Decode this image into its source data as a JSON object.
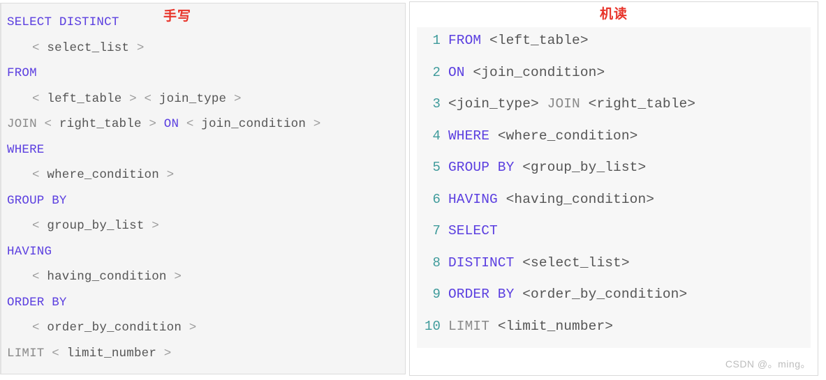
{
  "left_panel": {
    "label": "手写",
    "label_color": "#e8342a",
    "lines": [
      {
        "indent": false,
        "tokens": [
          {
            "t": "SELECT DISTINCT",
            "c": "kw"
          }
        ]
      },
      {
        "indent": true,
        "tokens": [
          {
            "t": "<",
            "c": "ang"
          },
          {
            "t": " select_list ",
            "c": "ph"
          },
          {
            "t": ">",
            "c": "ang"
          }
        ]
      },
      {
        "indent": false,
        "tokens": [
          {
            "t": "FROM",
            "c": "kw"
          }
        ]
      },
      {
        "indent": true,
        "tokens": [
          {
            "t": "<",
            "c": "ang"
          },
          {
            "t": " left_table ",
            "c": "ph"
          },
          {
            "t": ">",
            "c": "ang"
          },
          {
            "t": " ",
            "c": "ph"
          },
          {
            "t": "<",
            "c": "ang"
          },
          {
            "t": " join_type ",
            "c": "ph"
          },
          {
            "t": ">",
            "c": "ang"
          }
        ]
      },
      {
        "indent": false,
        "tokens": [
          {
            "t": "JOIN",
            "c": "gray"
          },
          {
            "t": " ",
            "c": "ph"
          },
          {
            "t": "<",
            "c": "ang"
          },
          {
            "t": " right_table ",
            "c": "ph"
          },
          {
            "t": ">",
            "c": "ang"
          },
          {
            "t": " ",
            "c": "ph"
          },
          {
            "t": "ON",
            "c": "kw"
          },
          {
            "t": " ",
            "c": "ph"
          },
          {
            "t": "<",
            "c": "ang"
          },
          {
            "t": " join_condition ",
            "c": "ph"
          },
          {
            "t": ">",
            "c": "ang"
          }
        ]
      },
      {
        "indent": false,
        "tokens": [
          {
            "t": "WHERE",
            "c": "kw"
          }
        ]
      },
      {
        "indent": true,
        "tokens": [
          {
            "t": "<",
            "c": "ang"
          },
          {
            "t": " where_condition ",
            "c": "ph"
          },
          {
            "t": ">",
            "c": "ang"
          }
        ]
      },
      {
        "indent": false,
        "tokens": [
          {
            "t": "GROUP BY",
            "c": "kw"
          }
        ]
      },
      {
        "indent": true,
        "tokens": [
          {
            "t": "<",
            "c": "ang"
          },
          {
            "t": " group_by_list ",
            "c": "ph"
          },
          {
            "t": ">",
            "c": "ang"
          }
        ]
      },
      {
        "indent": false,
        "tokens": [
          {
            "t": "HAVING",
            "c": "kw"
          }
        ]
      },
      {
        "indent": true,
        "tokens": [
          {
            "t": "<",
            "c": "ang"
          },
          {
            "t": " having_condition ",
            "c": "ph"
          },
          {
            "t": ">",
            "c": "ang"
          }
        ]
      },
      {
        "indent": false,
        "tokens": [
          {
            "t": "ORDER BY",
            "c": "kw"
          }
        ]
      },
      {
        "indent": true,
        "tokens": [
          {
            "t": "<",
            "c": "ang"
          },
          {
            "t": " order_by_condition ",
            "c": "ph"
          },
          {
            "t": ">",
            "c": "ang"
          }
        ]
      },
      {
        "indent": false,
        "tokens": [
          {
            "t": "LIMIT",
            "c": "gray"
          },
          {
            "t": " ",
            "c": "ph"
          },
          {
            "t": "<",
            "c": "ang"
          },
          {
            "t": " limit_number ",
            "c": "ph"
          },
          {
            "t": ">",
            "c": "ang"
          }
        ]
      }
    ],
    "plain_text": [
      "SELECT DISTINCT",
      "    < select_list >",
      "FROM",
      "    < left_table > < join_type >",
      "JOIN < right_table > ON < join_condition >",
      "WHERE",
      "    < where_condition >",
      "GROUP BY",
      "    < group_by_list >",
      "HAVING",
      "    < having_condition >",
      "ORDER BY",
      "    < order_by_condition >",
      "LIMIT < limit_number >"
    ]
  },
  "right_panel": {
    "label": "机读",
    "label_color": "#e8342a",
    "line_number_color": "#3f9b9b",
    "lines": [
      {
        "no": "1",
        "tokens": [
          {
            "t": "FROM",
            "c": "kw"
          },
          {
            "t": " ",
            "c": "ph"
          },
          {
            "t": "<left_table>",
            "c": "ph"
          }
        ]
      },
      {
        "no": "2",
        "tokens": [
          {
            "t": "ON",
            "c": "kw"
          },
          {
            "t": " ",
            "c": "ph"
          },
          {
            "t": "<join_condition>",
            "c": "ph"
          }
        ]
      },
      {
        "no": "3",
        "tokens": [
          {
            "t": "<join_type>",
            "c": "ph"
          },
          {
            "t": " ",
            "c": "ph"
          },
          {
            "t": "JOIN",
            "c": "gray"
          },
          {
            "t": " ",
            "c": "ph"
          },
          {
            "t": "<right_table>",
            "c": "ph"
          }
        ]
      },
      {
        "no": "4",
        "tokens": [
          {
            "t": "WHERE",
            "c": "kw"
          },
          {
            "t": " ",
            "c": "ph"
          },
          {
            "t": "<where_condition>",
            "c": "ph"
          }
        ]
      },
      {
        "no": "5",
        "tokens": [
          {
            "t": "GROUP BY",
            "c": "kw"
          },
          {
            "t": " ",
            "c": "ph"
          },
          {
            "t": "<group_by_list>",
            "c": "ph"
          }
        ]
      },
      {
        "no": "6",
        "tokens": [
          {
            "t": "HAVING",
            "c": "kw"
          },
          {
            "t": " ",
            "c": "ph"
          },
          {
            "t": "<having_condition>",
            "c": "ph"
          }
        ]
      },
      {
        "no": "7",
        "tokens": [
          {
            "t": "SELECT",
            "c": "kw"
          }
        ]
      },
      {
        "no": "8",
        "tokens": [
          {
            "t": "DISTINCT",
            "c": "kw"
          },
          {
            "t": " ",
            "c": "ph"
          },
          {
            "t": "<select_list>",
            "c": "ph"
          }
        ]
      },
      {
        "no": "9",
        "tokens": [
          {
            "t": "ORDER BY",
            "c": "kw"
          },
          {
            "t": " ",
            "c": "ph"
          },
          {
            "t": "<order_by_condition>",
            "c": "ph"
          }
        ]
      },
      {
        "no": "10",
        "tokens": [
          {
            "t": "LIMIT",
            "c": "gray"
          },
          {
            "t": " ",
            "c": "ph"
          },
          {
            "t": "<limit_number>",
            "c": "ph"
          }
        ]
      }
    ],
    "plain_text": [
      "1 FROM <left_table>",
      "2 ON <join_condition>",
      "3 <join_type> JOIN <right_table>",
      "4 WHERE <where_condition>",
      "5 GROUP BY <group_by_list>",
      "6 HAVING <having_condition>",
      "7 SELECT",
      "8 DISTINCT <select_list>",
      "9 ORDER BY <order_by_condition>",
      "10 LIMIT <limit_number>"
    ],
    "watermark": "CSDN @。ming。"
  }
}
